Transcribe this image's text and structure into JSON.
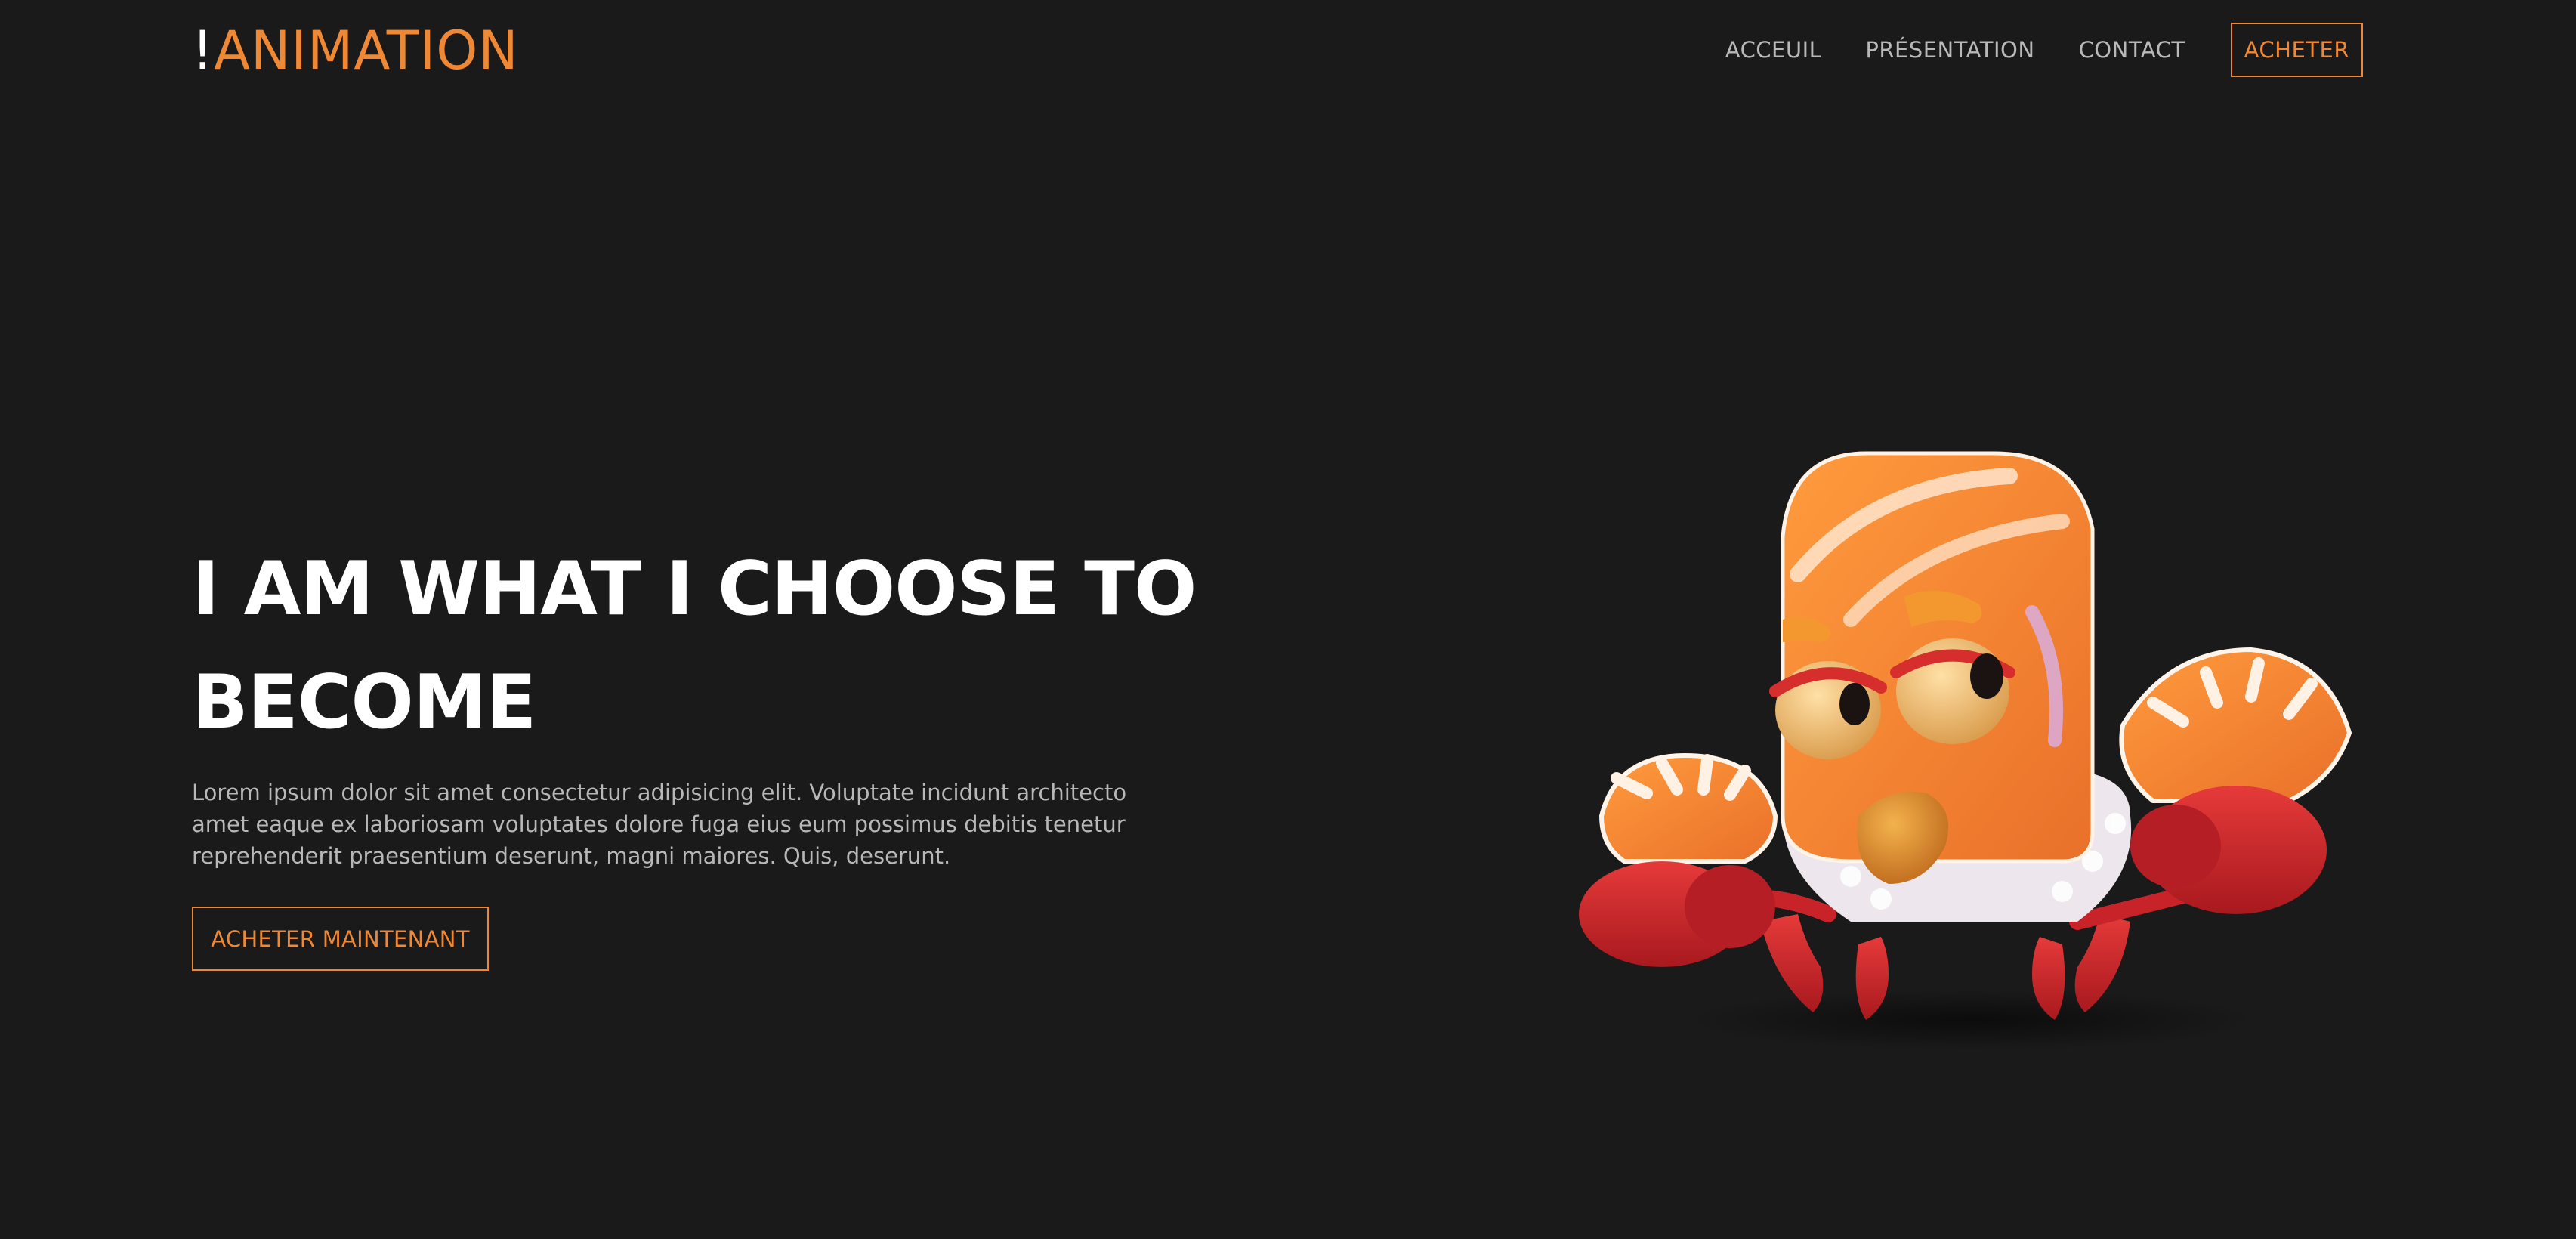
{
  "header": {
    "logo_mark": "!",
    "logo_name": "ANIMATION",
    "nav": [
      {
        "label": "ACCEUIL"
      },
      {
        "label": "PRÉSENTATION"
      },
      {
        "label": "CONTACT"
      }
    ],
    "buy_label": "ACHETER"
  },
  "hero": {
    "title": "I AM WHAT I CHOOSE TO BECOME",
    "text": "Lorem ipsum dolor sit amet consectetur adipisicing elit. Voluptate incidunt architecto amet eaque ex laboriosam voluptates dolore fuga eius eum possimus debitis tenetur reprehenderit praesentium deserunt, magni maiores. Quis, deserunt.",
    "cta_label": "ACHETER MAINTENANT"
  },
  "illustration": {
    "icon": "salmon-sushi-crab-mascot"
  },
  "colors": {
    "background": "#1a1a1b",
    "accent": "#ee8834",
    "nav_text": "#b9b9b9",
    "body_text": "#b8b8b8"
  }
}
